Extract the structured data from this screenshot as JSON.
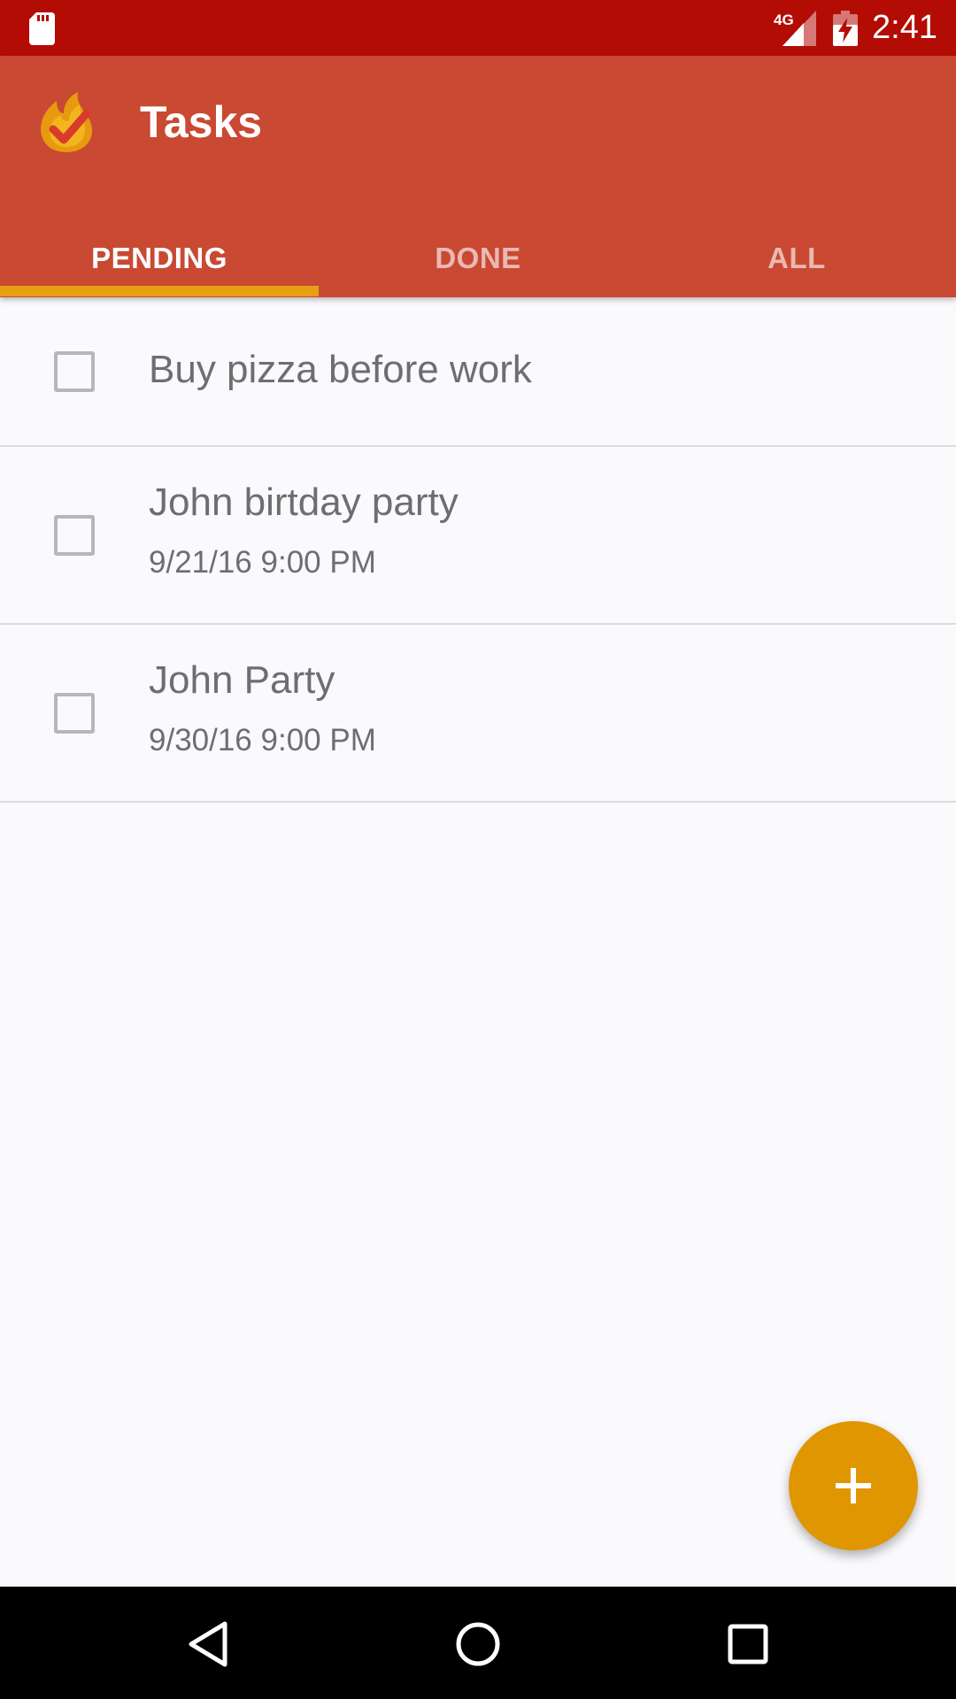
{
  "status_bar": {
    "network_label": "4G",
    "time": "2:41",
    "icons": [
      "sd-card-icon",
      "signal-icon",
      "battery-charging-icon"
    ]
  },
  "app_bar": {
    "title": "Tasks",
    "logo_icon": "flame-check-logo-icon",
    "background_color": "#C94933"
  },
  "tabs": [
    {
      "label": "PENDING",
      "selected": true
    },
    {
      "label": "DONE",
      "selected": false
    },
    {
      "label": "ALL",
      "selected": false
    }
  ],
  "tasks": [
    {
      "title": "Buy pizza before work",
      "date": "",
      "checked": false
    },
    {
      "title": "John birtday party",
      "date": "9/21/16 9:00 PM",
      "checked": false
    },
    {
      "title": "John Party",
      "date": "9/30/16 9:00 PM",
      "checked": false
    }
  ],
  "fab": {
    "icon": "plus-icon",
    "color": "#DF9601"
  },
  "nav_bar": {
    "icons": [
      "back-icon",
      "home-icon",
      "recents-icon"
    ]
  },
  "colors": {
    "status_bar": "#B30C05",
    "accent": "#E7A013",
    "background": "#FAF9FC"
  }
}
